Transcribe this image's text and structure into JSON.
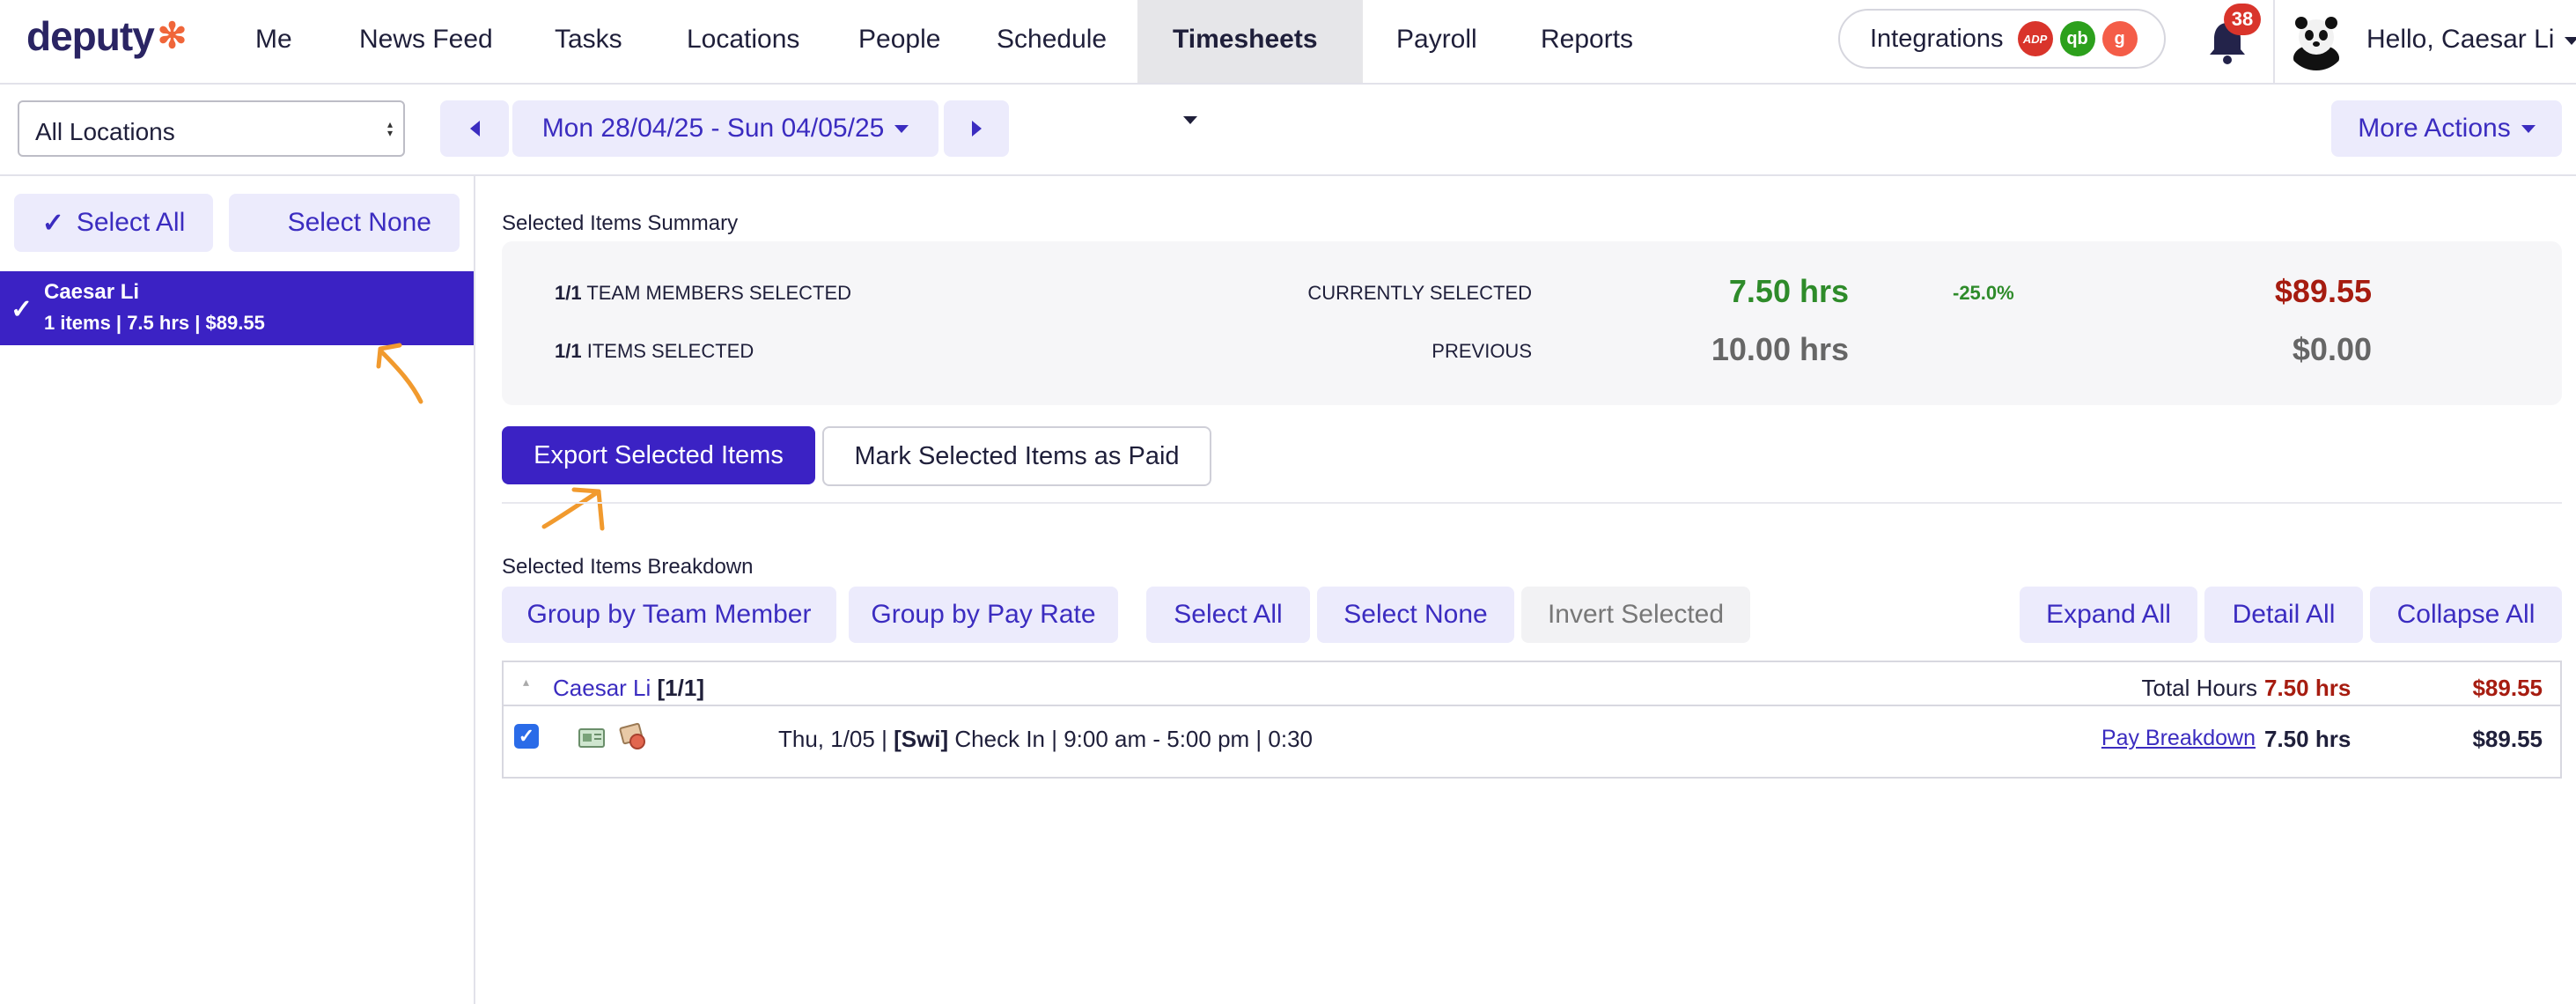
{
  "brand": {
    "name": "deputy"
  },
  "nav": {
    "me": "Me",
    "news_feed": "News Feed",
    "tasks": "Tasks",
    "locations": "Locations",
    "people": "People",
    "schedule": "Schedule",
    "timesheets": "Timesheets",
    "payroll": "Payroll",
    "reports": "Reports"
  },
  "integrations": {
    "label": "Integrations",
    "icons": [
      "adp-icon",
      "quickbooks-icon",
      "gusto-icon"
    ],
    "adp_glyph": "ADP",
    "qb_glyph": "qb",
    "gusto_glyph": "g",
    "colors": {
      "adp": "#d9342b",
      "qb": "#2ca01c",
      "gusto": "#f45d48"
    }
  },
  "notifications": {
    "count": "38"
  },
  "user": {
    "greeting": "Hello, Caesar Li"
  },
  "toolbar": {
    "location": "All Locations",
    "date_range": "Mon 28/04/25 - Sun 04/05/25",
    "more_actions": "More Actions"
  },
  "sidebar": {
    "select_all": "Select All",
    "select_all_check": "✓",
    "select_none": "Select None",
    "members": [
      {
        "check": "✓",
        "name": "Caesar Li",
        "meta": "1 items | 7.5 hrs | $89.55"
      }
    ]
  },
  "summary": {
    "title": "Selected Items Summary",
    "team_count": "1/1",
    "team_label": "TEAM MEMBERS SELECTED",
    "items_count": "1/1",
    "items_label": "ITEMS SELECTED",
    "current_label": "CURRENTLY SELECTED",
    "current_hours": "7.50 hrs",
    "change_pct": "-25.0%",
    "current_cost": "$89.55",
    "previous_label": "PREVIOUS",
    "previous_hours": "10.00 hrs",
    "previous_cost": "$0.00"
  },
  "actions": {
    "export": "Export Selected Items",
    "mark_paid": "Mark Selected Items as Paid"
  },
  "breakdown": {
    "title": "Selected Items Breakdown",
    "group_member": "Group by Team Member",
    "group_rate": "Group by Pay Rate",
    "select_all": "Select All",
    "select_none": "Select None",
    "invert": "Invert Selected",
    "expand_all": "Expand All",
    "detail_all": "Detail All",
    "collapse_all": "Collapse All",
    "group": {
      "name": "Caesar Li",
      "count": "[1/1]",
      "total_label": "Total Hours",
      "total_hours": "7.50 hrs",
      "total_cost": "$89.55"
    },
    "rows": [
      {
        "date": "Thu, 1/05 | ",
        "area": "[Swi]",
        "detail": " Check In | 9:00 am - 5:00 pm | 0:30",
        "pay_link": "Pay Breakdown",
        "hours": "7.50 hrs",
        "cost": "$89.55"
      }
    ]
  },
  "colors": {
    "primary": "#3b22c4",
    "accent_light": "#ecebfc",
    "positive": "#2e8b2a",
    "cost_red": "#a61c10"
  }
}
